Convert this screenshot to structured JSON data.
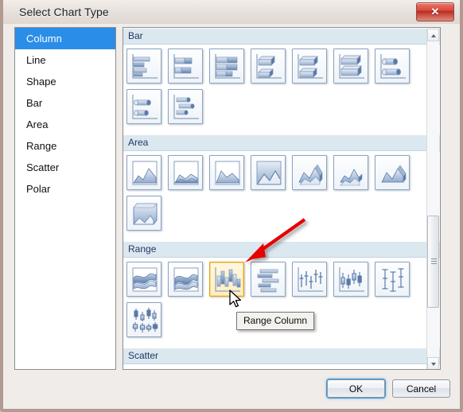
{
  "window": {
    "title": "Select Chart Type",
    "close_label": "✕",
    "close_icon": "close-icon"
  },
  "sidebar": {
    "items": [
      {
        "label": "Column",
        "selected": true
      },
      {
        "label": "Line",
        "selected": false
      },
      {
        "label": "Shape",
        "selected": false
      },
      {
        "label": "Bar",
        "selected": false
      },
      {
        "label": "Area",
        "selected": false
      },
      {
        "label": "Range",
        "selected": false
      },
      {
        "label": "Scatter",
        "selected": false
      },
      {
        "label": "Polar",
        "selected": false
      }
    ]
  },
  "gallery": {
    "sections": [
      {
        "title": "Bar",
        "rows": [
          [
            {
              "icon": "bar-clustered-icon",
              "selected": false
            },
            {
              "icon": "bar-stacked-icon",
              "selected": false
            },
            {
              "icon": "bar-stacked-100-icon",
              "selected": false
            },
            {
              "icon": "bar-3d-clustered-icon",
              "selected": false
            },
            {
              "icon": "bar-3d-stacked-icon",
              "selected": false
            },
            {
              "icon": "bar-3d-stacked-100-icon",
              "selected": false
            },
            {
              "icon": "bar-cylinder-clustered-icon",
              "selected": false
            }
          ],
          [
            {
              "icon": "bar-cylinder-stacked-icon",
              "selected": false
            },
            {
              "icon": "bar-cylinder-3d-icon",
              "selected": false
            }
          ]
        ]
      },
      {
        "title": "Area",
        "rows": [
          [
            {
              "icon": "area-basic-icon",
              "selected": false
            },
            {
              "icon": "area-stacked-icon",
              "selected": false
            },
            {
              "icon": "area-stacked-100-icon",
              "selected": false
            },
            {
              "icon": "area-filled-icon",
              "selected": false
            },
            {
              "icon": "area-3d-clustered-icon",
              "selected": false
            },
            {
              "icon": "area-3d-stacked-icon",
              "selected": false
            },
            {
              "icon": "area-3d-stacked-100-icon",
              "selected": false
            }
          ],
          [
            {
              "icon": "area-3d-solid-icon",
              "selected": false
            }
          ]
        ]
      },
      {
        "title": "Range",
        "rows": [
          [
            {
              "icon": "range-area-icon",
              "selected": false
            },
            {
              "icon": "range-spline-area-icon",
              "selected": false
            },
            {
              "icon": "range-column-icon",
              "selected": true
            },
            {
              "icon": "range-bar-icon",
              "selected": false
            },
            {
              "icon": "range-high-low-icon",
              "selected": false
            },
            {
              "icon": "range-candlestick-icon",
              "selected": false
            },
            {
              "icon": "range-error-bar-icon",
              "selected": false
            }
          ],
          [
            {
              "icon": "range-box-whisker-icon",
              "selected": false
            }
          ]
        ]
      },
      {
        "title": "Scatter",
        "rows": []
      }
    ]
  },
  "tooltip": {
    "text": "Range Column"
  },
  "annotation": {
    "arrow_color": "#e60000",
    "arrow_name": "red-pointer-arrow"
  },
  "footer": {
    "ok_label": "OK",
    "cancel_label": "Cancel"
  },
  "scrollbar": {
    "up_icon": "scroll-up-arrow-icon",
    "down_icon": "scroll-down-arrow-icon",
    "thumb_name": "scrollbar-thumb"
  },
  "colors": {
    "selection_blue": "#2a8ee8",
    "section_header_bg": "#dce8f0",
    "section_header_text": "#1f3864",
    "highlight_border": "#e3a322",
    "accent_red": "#e60000"
  }
}
